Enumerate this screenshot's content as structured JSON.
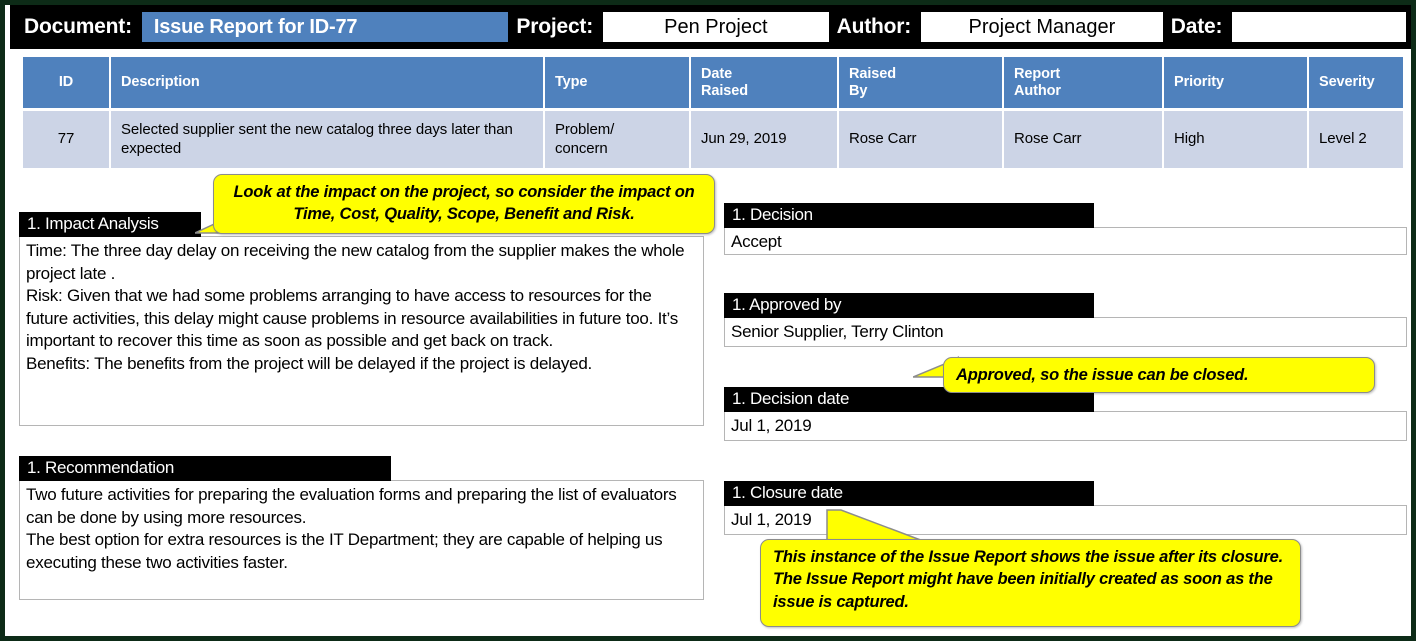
{
  "topbar": {
    "document_label": "Document:",
    "document_value": "Issue Report for  ID-77",
    "project_label": "Project:",
    "project_value": "Pen Project",
    "author_label": "Author:",
    "author_value": "Project Manager",
    "date_label": "Date:",
    "date_value": ""
  },
  "table": {
    "headers": {
      "id": "ID",
      "description": "Description",
      "type": "Type",
      "date_raised_line1": "Date",
      "date_raised_line2": "Raised",
      "raised_by_line1": "Raised",
      "raised_by_line2": "By",
      "report_author_line1": "Report",
      "report_author_line2": "Author",
      "priority": "Priority",
      "severity": "Severity"
    },
    "row": {
      "id": "77",
      "description": "Selected supplier sent the new catalog three days later than expected",
      "type": "Problem/\nconcern",
      "date_raised": "Jun 29, 2019",
      "raised_by": "Rose Carr",
      "report_author": "Rose Carr",
      "priority": "High",
      "severity": "Level 2"
    }
  },
  "sections": {
    "impact_analysis": {
      "title": "1. Impact Analysis",
      "body": "Time: The three day delay on receiving the new catalog from the supplier makes the whole project late .\nRisk: Given that we had some problems arranging to have access to resources for the future activities, this delay might cause problems in resource availabilities in future too. It’s important to recover this time as soon as possible and get back on track.\nBenefits: The benefits from the project will be delayed if the project is delayed."
    },
    "recommendation": {
      "title": "1. Recommendation",
      "body": "Two future activities for preparing the evaluation forms and preparing the list of evaluators can be done by using more resources.\nThe best option for extra resources is the IT Department; they are capable of helping us executing these two activities faster."
    },
    "decision": {
      "title": "1. Decision",
      "body": "Accept"
    },
    "approved_by": {
      "title": "1. Approved by",
      "body": "Senior Supplier, Terry Clinton"
    },
    "decision_date": {
      "title": "1. Decision date",
      "body": "Jul 1, 2019"
    },
    "closure_date": {
      "title": "1. Closure date",
      "body": "Jul 1, 2019"
    }
  },
  "callouts": {
    "impact": "Look at the impact on the project, so consider the impact on Time, Cost, Quality, Scope, Benefit and Risk.",
    "approved": "Approved, so the issue can be closed.",
    "closure_part1": "This instance of the Issue Report shows the issue after its closure. The ",
    "closure_bold": "Issue Report",
    "closure_part2": " might have been initially created as soon as the issue is captured."
  },
  "colors": {
    "accent_blue": "#4f81bd",
    "row_blue": "#ccd4e6",
    "callout_yellow": "#ffff00",
    "frame_green": "#0d2b17",
    "header_black": "#000000"
  }
}
